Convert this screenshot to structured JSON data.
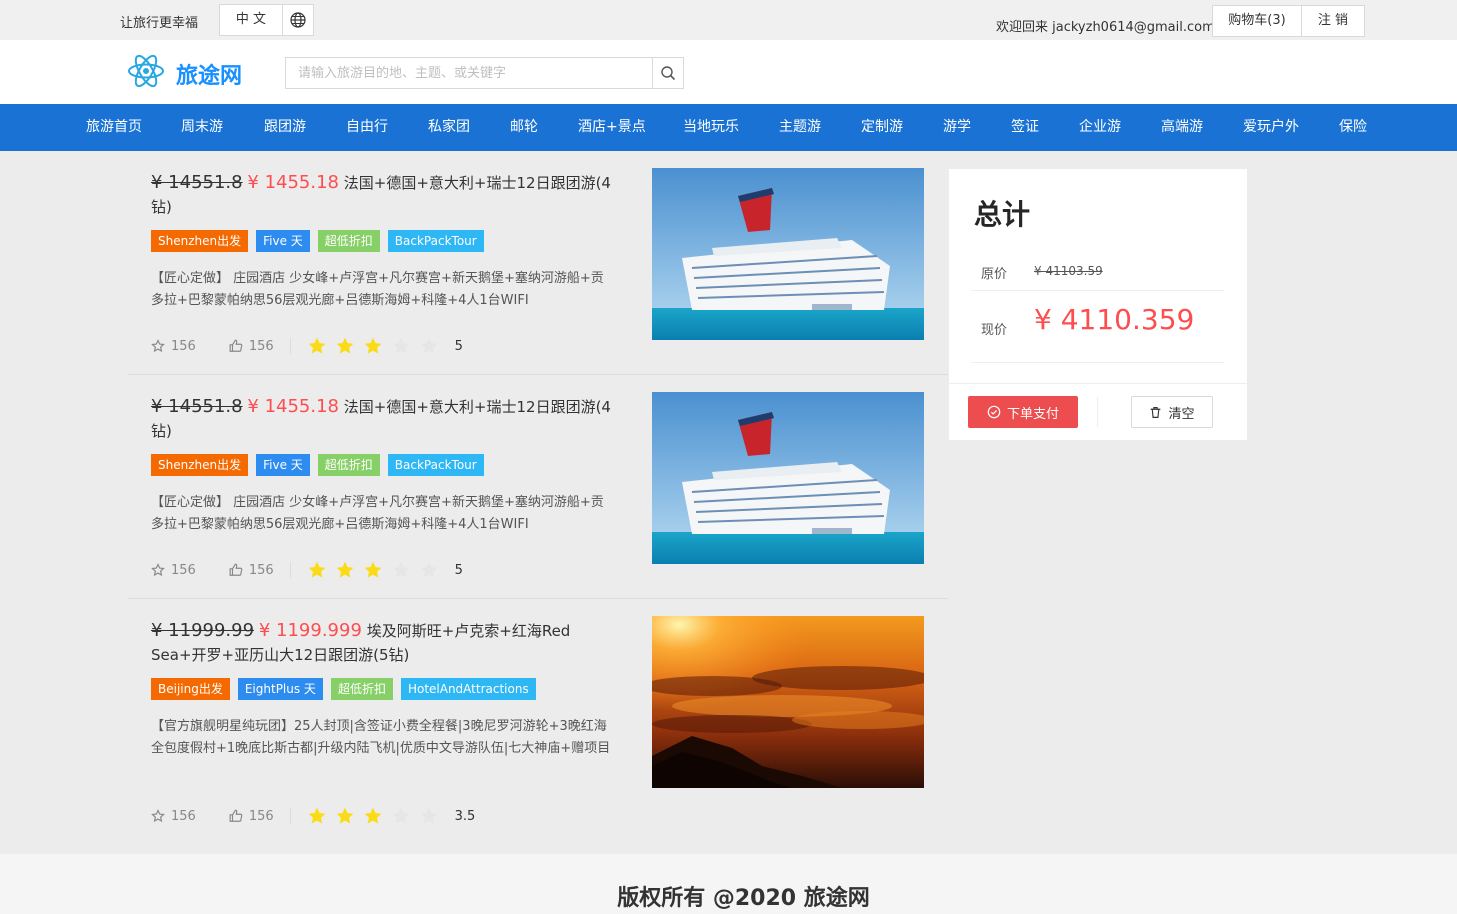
{
  "topbar": {
    "slogan": "让旅行更幸福",
    "language": "中 文",
    "welcome": "欢迎回来 jackyzh0614@gmail.com",
    "cart": "购物车(3)",
    "logout": "注 销"
  },
  "header": {
    "logo": "旅途网",
    "search_placeholder": "请输入旅游目的地、主题、或关键字"
  },
  "nav": [
    "旅游首页",
    "周末游",
    "跟团游",
    "自由行",
    "私家团",
    "邮轮",
    "酒店+景点",
    "当地玩乐",
    "主题游",
    "定制游",
    "游学",
    "签证",
    "企业游",
    "高端游",
    "爱玩户外",
    "保险"
  ],
  "products": [
    {
      "original_price": "¥ 14551.8",
      "price": "¥ 1455.18",
      "title": "法国+德国+意大利+瑞士12日跟团游(4钻)",
      "tags": [
        "Shenzhen出发",
        "Five 天",
        "超低折扣",
        "BackPackTour"
      ],
      "description": "【匠心定做】 庄园酒店 少女峰+卢浮宫+凡尔赛宫+新天鹅堡+塞纳河游船+贡多拉+巴黎蒙帕纳思56层观光廊+吕德斯海姆+科隆+4人1台WIFI",
      "favorites": "156",
      "likes": "156",
      "rating": "5",
      "stars_filled": 3,
      "image": "cruise-ship"
    },
    {
      "original_price": "¥ 14551.8",
      "price": "¥ 1455.18",
      "title": "法国+德国+意大利+瑞士12日跟团游(4钻)",
      "tags": [
        "Shenzhen出发",
        "Five 天",
        "超低折扣",
        "BackPackTour"
      ],
      "description": "【匠心定做】 庄园酒店 少女峰+卢浮宫+凡尔赛宫+新天鹅堡+塞纳河游船+贡多拉+巴黎蒙帕纳思56层观光廊+吕德斯海姆+科隆+4人1台WIFI",
      "favorites": "156",
      "likes": "156",
      "rating": "5",
      "stars_filled": 3,
      "image": "cruise-ship"
    },
    {
      "original_price": "¥ 11999.99",
      "price": "¥ 1199.999",
      "title": "埃及阿斯旺+卢克索+红海Red Sea+开罗+亚历山大12日跟团游(5钻)",
      "tags": [
        "Beijing出发",
        "EightPlus 天",
        "超低折扣",
        "HotelAndAttractions"
      ],
      "description": "【官方旗舰明星纯玩团】25人封顶|含签证小费全程餐|3晚尼罗河游轮+3晚红海全包度假村+1晚底比斯古都|升级内陆飞机|优质中文导游队伍|七大神庙+赠项目",
      "favorites": "156",
      "likes": "156",
      "rating": "3.5",
      "stars_filled": 3,
      "image": "sunset-clouds"
    }
  ],
  "summary": {
    "title": "总计",
    "original_label": "原价",
    "original_value": "¥ 41103.59",
    "current_label": "现价",
    "current_value": "¥ 4110.359",
    "pay_label": "下单支付",
    "clear_label": "清空"
  },
  "footer": {
    "copyright": "版权所有 @2020 旅途网"
  },
  "colors": {
    "nav_bg": "#1a73d4",
    "price_red": "#ff4d4f",
    "tag_orange": "#f56a00",
    "tag_blue": "#2d8cf0",
    "tag_green": "#87d068",
    "tag_cyan": "#2db7f5",
    "star_gold": "#fadb14"
  }
}
